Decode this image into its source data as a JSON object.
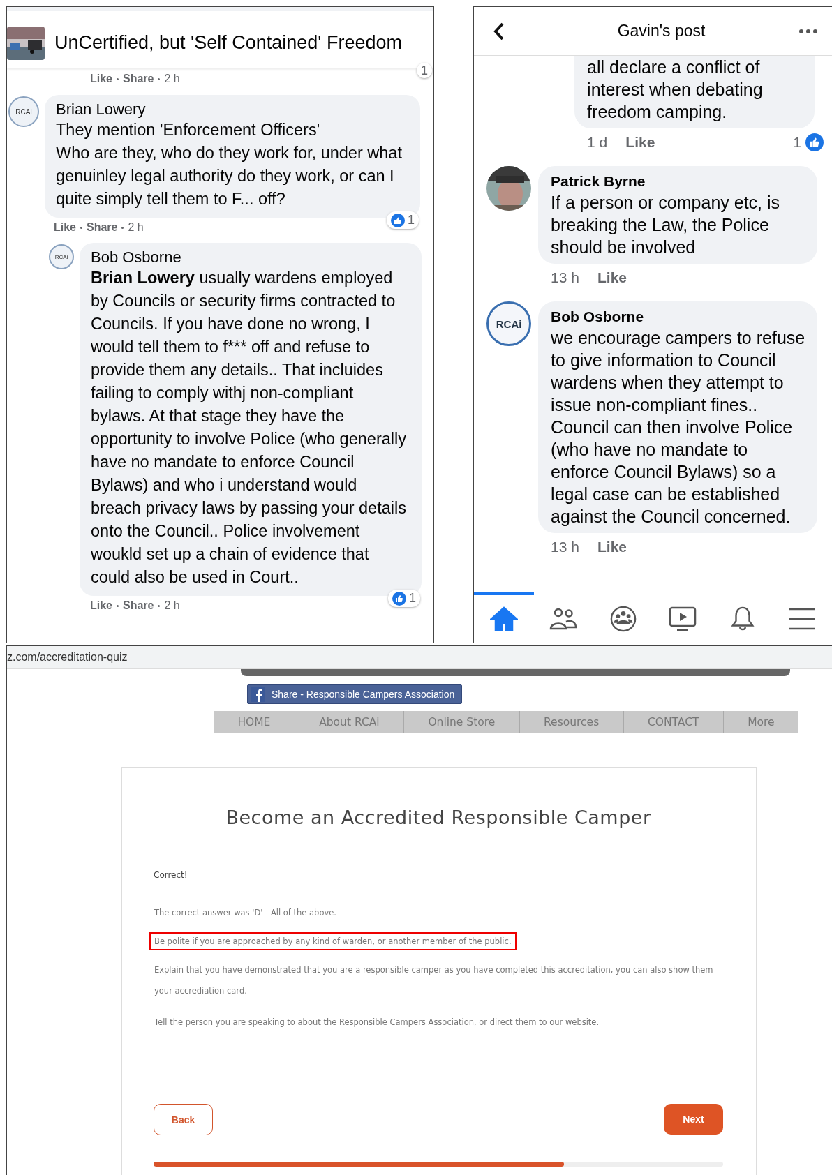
{
  "left_post": {
    "title": "UnCertified, but 'Self Contained' Freedom",
    "top_actions": {
      "like": "Like",
      "share": "Share",
      "time": "2 h",
      "reactions": "1"
    },
    "comments": [
      {
        "author": "Brian Lowery",
        "avatar": "RCAi",
        "reply": false,
        "text": "They mention 'Enforcement Officers'\nWho are they, who do they work for, under what genuinley legal authority do they work, or can I quite simply tell them to F... off?",
        "like": "Like",
        "share": "Share",
        "time": "2 h",
        "reactions": "1"
      },
      {
        "author": "Bob Osborne",
        "avatar": "RCAi",
        "reply": true,
        "text": "**Brian Lowery** usually wardens employed by Councils or security firms contracted to Councils. If you have done no wrong, I would tell them to f*** off and refuse to provide them any details.. That incluides failing to comply withj non-compliant bylaws. At that stage they have the opportunity to involve Police (who generally have no mandate to enforce Council Bylaws) and who i understand would breach privacy laws by passing your details onto the Council.. Police involvement woukld set up a chain of evidence that could also be used in Court..",
        "like": "Like",
        "share": "Share",
        "time": "2 h",
        "reactions": "1"
      }
    ]
  },
  "right_post": {
    "title": "Gavin's post",
    "comments": [
      {
        "kind": "partial",
        "text": "all declare a conflict of interest when debating freedom camping.",
        "time": "1 d",
        "like": "Like",
        "reactions": "1"
      },
      {
        "author": "Patrick Byrne",
        "text": "If a person or company etc, is breaking the Law, the Police should be involved",
        "time": "13 h",
        "like": "Like"
      },
      {
        "kind": "logo",
        "author": "Bob Osborne",
        "avatar": "RCAi",
        "text": "we encourage campers to refuse to give information to Council wardens when they attempt to issue non-compliant fines.. Council can then involve Police (who have no mandate to enforce Council Bylaws) so a legal case can be established against the Council concerned.",
        "time": "13 h",
        "like": "Like"
      }
    ],
    "tabs": [
      {
        "kind": "home",
        "selected": true
      },
      {
        "kind": "friends",
        "selected": false
      },
      {
        "kind": "groups",
        "selected": false
      },
      {
        "kind": "watch",
        "selected": false
      },
      {
        "kind": "notifications",
        "selected": false
      },
      {
        "kind": "menu",
        "selected": false
      }
    ]
  },
  "quiz_page": {
    "url": "z.com/accreditation-quiz",
    "share_button": "Share - Responsible Campers Association",
    "nav": [
      "HOME",
      "About RCAi",
      "Online Store",
      "Resources",
      "CONTACT",
      "More"
    ],
    "title": "Become an Accredited Responsible Camper",
    "status": "Correct!",
    "paragraphs": [
      {
        "text": "The correct answer was 'D' - All of the above.",
        "highlighted": false
      },
      {
        "text": "Be polite if you are approached by any kind of warden, or another member of the public.",
        "highlighted": true
      },
      {
        "text": "Explain that you have demonstrated that you are a responsible camper as you have completed this accreditation, you can also show them your accrediation card.",
        "highlighted": false
      },
      {
        "text": "Tell the person you are speaking to about the Responsible Campers Association, or direct them to our website.",
        "highlighted": false
      }
    ],
    "back": "Back",
    "next": "Next",
    "progress": {
      "level": 0.72
    }
  }
}
